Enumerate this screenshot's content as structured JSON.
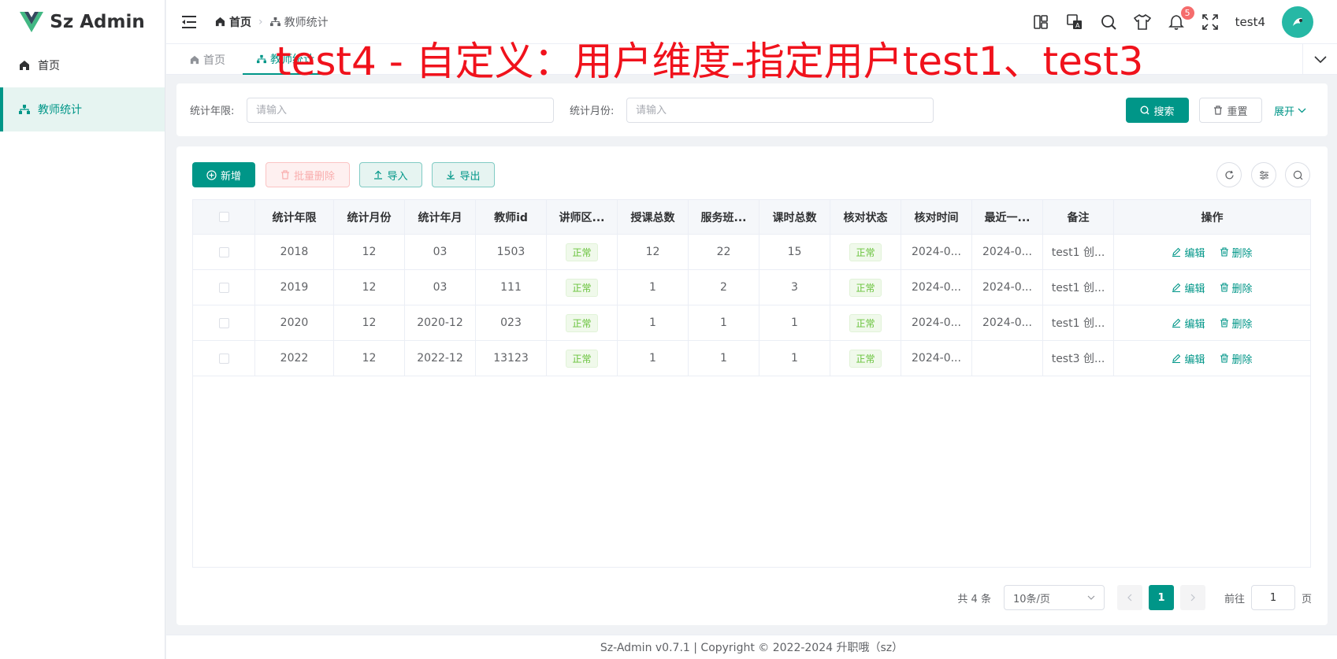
{
  "app": {
    "title": "Sz Admin"
  },
  "sidebar": {
    "items": [
      {
        "label": "首页"
      },
      {
        "label": "教师统计"
      }
    ]
  },
  "header": {
    "breadcrumb": [
      "首页",
      "教师统计"
    ],
    "username": "test4",
    "notification_count": "5"
  },
  "tabs": [
    {
      "label": "首页"
    },
    {
      "label": "教师统计"
    }
  ],
  "overlay_annotation": "test4 - 自定义：用户维度-指定用户test1、test3",
  "search": {
    "fields": [
      {
        "label": "统计年限:",
        "placeholder": "请输入"
      },
      {
        "label": "统计月份:",
        "placeholder": "请输入"
      }
    ],
    "search_label": "搜索",
    "reset_label": "重置",
    "expand_label": "展开"
  },
  "toolbar": {
    "add_label": "新增",
    "batch_delete_label": "批量删除",
    "import_label": "导入",
    "export_label": "导出"
  },
  "table": {
    "columns": [
      "统计年限",
      "统计月份",
      "统计年月",
      "教师id",
      "讲师区...",
      "授课总数",
      "服务班...",
      "课时总数",
      "核对状态",
      "核对时间",
      "最近一...",
      "备注",
      "操作"
    ],
    "rows": [
      [
        "2018",
        "12",
        "03",
        "1503",
        "正常",
        "12",
        "22",
        "15",
        "正常",
        "2024-0...",
        "2024-0...",
        "test1 创..."
      ],
      [
        "2019",
        "12",
        "03",
        "111",
        "正常",
        "1",
        "2",
        "3",
        "正常",
        "2024-0...",
        "2024-0...",
        "test1 创..."
      ],
      [
        "2020",
        "12",
        "2020-12",
        "023",
        "正常",
        "1",
        "1",
        "1",
        "正常",
        "2024-0...",
        "2024-0...",
        "test1 创..."
      ],
      [
        "2022",
        "12",
        "2022-12",
        "13123",
        "正常",
        "1",
        "1",
        "1",
        "正常",
        "2024-0...",
        "",
        "test3 创..."
      ]
    ],
    "edit_label": "编辑",
    "delete_label": "删除"
  },
  "pagination": {
    "total": "共 4 条",
    "page_size": "10条/页",
    "current_page": "1",
    "goto_label": "前往",
    "goto_value": "1",
    "page_unit": "页"
  },
  "footer": "Sz-Admin v0.7.1 | Copyright © 2022-2024 升职哦（sz）",
  "colors": {
    "primary": "#009688",
    "danger": "#f56c6c",
    "success": "#67c23a",
    "annotation": "#f0121c"
  }
}
